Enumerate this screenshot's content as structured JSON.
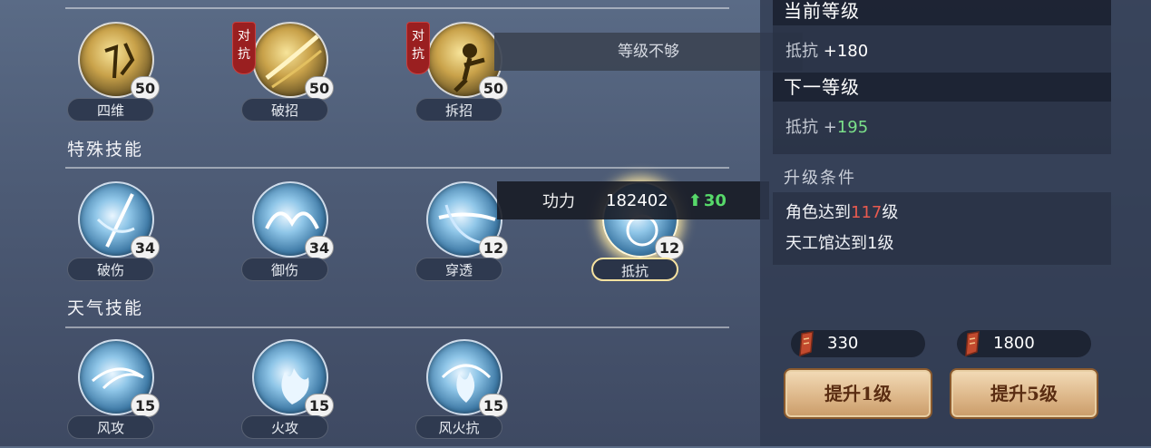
{
  "sections": {
    "special_title": "特殊技能",
    "weather_title": "天气技能"
  },
  "top_skills": [
    {
      "name": "四维",
      "level": "50",
      "tag": ""
    },
    {
      "name": "破招",
      "level": "50",
      "tag": "对抗"
    },
    {
      "name": "拆招",
      "level": "50",
      "tag": "对抗"
    }
  ],
  "special_skills": [
    {
      "name": "破伤",
      "level": "34"
    },
    {
      "name": "御伤",
      "level": "34"
    },
    {
      "name": "穿透",
      "level": "12"
    },
    {
      "name": "抵抗",
      "level": "12"
    }
  ],
  "weather_skills": [
    {
      "name": "风攻",
      "level": "15"
    },
    {
      "name": "火攻",
      "level": "15"
    },
    {
      "name": "风火抗",
      "level": "15"
    }
  ],
  "tooltip": {
    "not_enough_level": "等级不够"
  },
  "power": {
    "label": "功力",
    "value": "182402",
    "increase": "30"
  },
  "info": {
    "current_title": "当前等级",
    "current_stat": "抵抗",
    "current_value": "+180",
    "next_title": "下一等级",
    "next_stat": "抵抗",
    "next_plus": "+",
    "next_value": "195",
    "cond_title": "升级条件",
    "cond1_pre": "角色达到",
    "cond1_num": "117",
    "cond1_post": "级",
    "cond2": "天工馆达到1级"
  },
  "costs": {
    "cost1": "330",
    "cost2": "1800"
  },
  "buttons": {
    "up1": "提升1级",
    "up5": "提升5级"
  },
  "colors": {
    "accent_green": "#57d96a",
    "warning_red": "#e85a4f",
    "button_gold": "#dcb587"
  }
}
